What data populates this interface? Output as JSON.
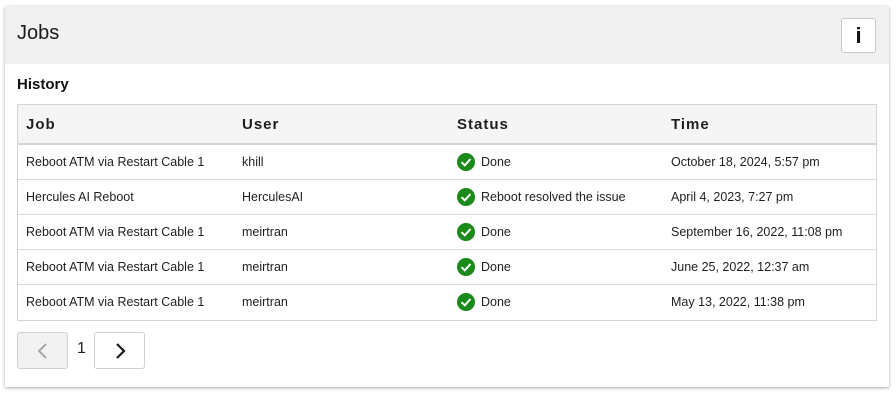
{
  "card": {
    "title": "Jobs",
    "info_button_label": "i"
  },
  "history": {
    "title": "History",
    "columns": [
      "Job",
      "User",
      "Status",
      "Time"
    ],
    "rows": [
      {
        "job": "Reboot ATM via Restart Cable 1",
        "user": "khill",
        "status": "Done",
        "time": "October 18, 2024, 5:57 pm"
      },
      {
        "job": "Hercules AI Reboot",
        "user": "HerculesAI",
        "status": "Reboot resolved the issue",
        "time": "April 4, 2023, 7:27 pm"
      },
      {
        "job": "Reboot ATM via Restart Cable 1",
        "user": "meirtran",
        "status": "Done",
        "time": "September 16, 2022, 11:08 pm"
      },
      {
        "job": "Reboot ATM via Restart Cable 1",
        "user": "meirtran",
        "status": "Done",
        "time": "June 25, 2022, 12:37 am"
      },
      {
        "job": "Reboot ATM via Restart Cable 1",
        "user": "meirtran",
        "status": "Done",
        "time": "May 13, 2022, 11:38 pm"
      }
    ]
  },
  "pagination": {
    "current_page": "1"
  },
  "colors": {
    "status_success": "#1a8a1a",
    "header_bg": "#f1f1f1"
  }
}
